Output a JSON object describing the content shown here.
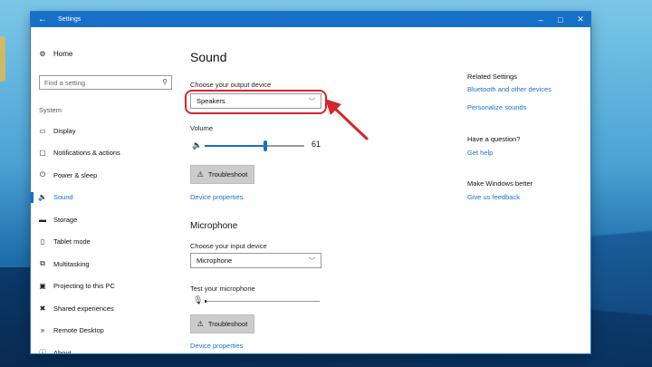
{
  "window": {
    "title": "Settings",
    "back_icon": "←",
    "minimize_icon": "–",
    "maximize_icon": "□",
    "close_icon": "✕"
  },
  "sidebar": {
    "home_label": "Home",
    "home_icon": "gear-icon",
    "search_placeholder": "Find a setting",
    "search_icon": "search-icon",
    "section_label": "System",
    "items": [
      {
        "label": "Display",
        "icon": "monitor-icon",
        "glyph": "▭"
      },
      {
        "label": "Notifications & actions",
        "icon": "notification-icon",
        "glyph": "▢"
      },
      {
        "label": "Power & sleep",
        "icon": "power-icon",
        "glyph": "⏻"
      },
      {
        "label": "Sound",
        "icon": "speaker-icon",
        "glyph": "🔉"
      },
      {
        "label": "Storage",
        "icon": "storage-icon",
        "glyph": "▬"
      },
      {
        "label": "Tablet mode",
        "icon": "tablet-icon",
        "glyph": "▯"
      },
      {
        "label": "Multitasking",
        "icon": "multitask-icon",
        "glyph": "⧉"
      },
      {
        "label": "Projecting to this PC",
        "icon": "project-icon",
        "glyph": "▣"
      },
      {
        "label": "Shared experiences",
        "icon": "shared-icon",
        "glyph": "✖"
      },
      {
        "label": "Remote Desktop",
        "icon": "remote-icon",
        "glyph": "»"
      },
      {
        "label": "About",
        "icon": "info-icon",
        "glyph": "ⓘ"
      }
    ],
    "active_item": "Sound"
  },
  "main": {
    "title": "Sound",
    "output_label": "Choose your output device",
    "output_value": "Speakers",
    "volume_label": "Volume",
    "volume_value": "61",
    "volume_level": 0.61,
    "troubleshoot_label": "Troubleshoot",
    "device_properties_label": "Device properties",
    "microphone_title": "Microphone",
    "input_label": "Choose your input device",
    "input_value": "Microphone",
    "test_mic_label": "Test your microphone",
    "mic_troubleshoot_label": "Troubleshoot",
    "mic_device_properties_label": "Device properties"
  },
  "related": {
    "heading": "Related Settings",
    "link1": "Bluetooth and other devices",
    "link2": "Personalize sounds",
    "question_heading": "Have a question?",
    "help_link": "Get help",
    "better_heading": "Make Windows better",
    "feedback_link": "Give us feedback"
  },
  "annotation": {
    "highlight_color": "#d8232a"
  },
  "colors": {
    "accent": "#1770c8",
    "annotation": "#d8232a"
  }
}
